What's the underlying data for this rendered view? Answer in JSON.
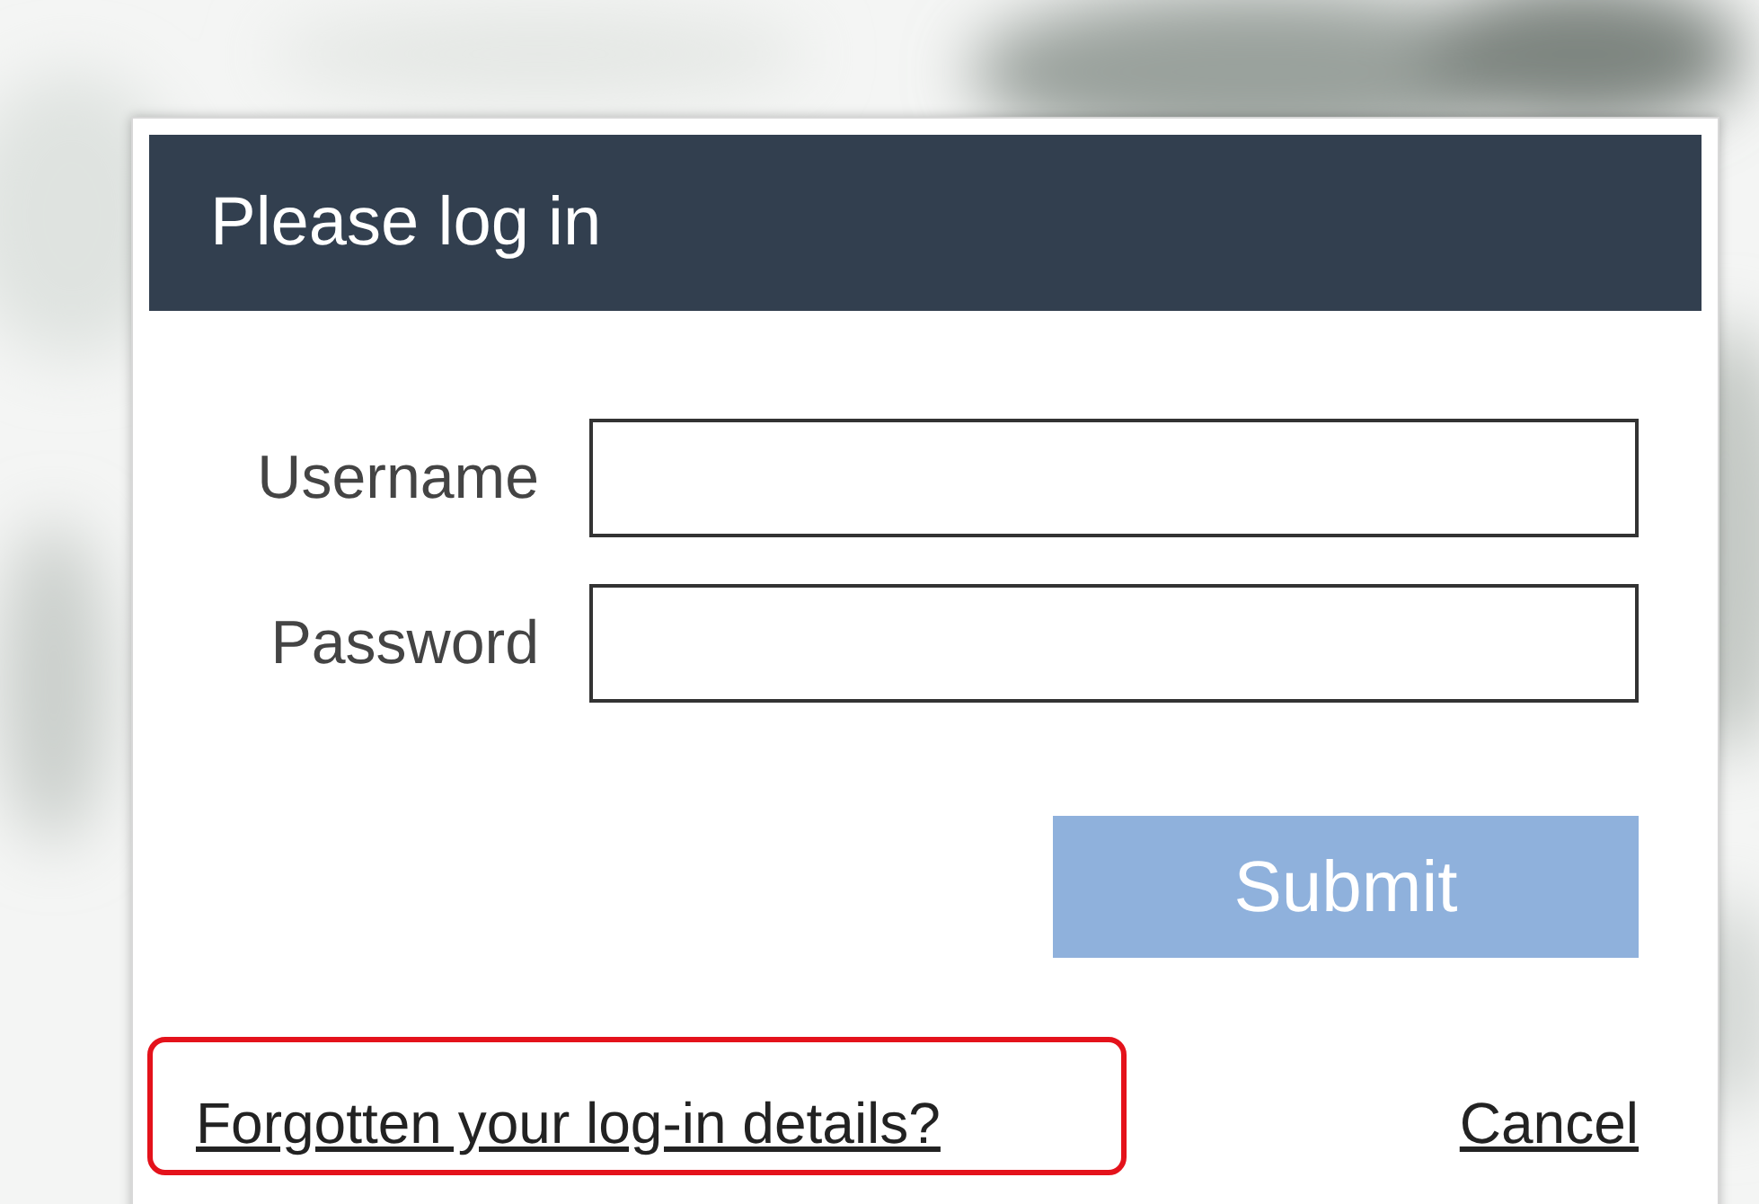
{
  "dialog": {
    "title": "Please log in",
    "fields": [
      {
        "label": "Username"
      },
      {
        "label": "Password"
      }
    ],
    "submit": {
      "label": "Submit",
      "disabled": true
    },
    "forgot_link": {
      "label": "Forgotten your log-in details?",
      "highlighted": true
    },
    "cancel_link": {
      "label": "Cancel"
    }
  }
}
